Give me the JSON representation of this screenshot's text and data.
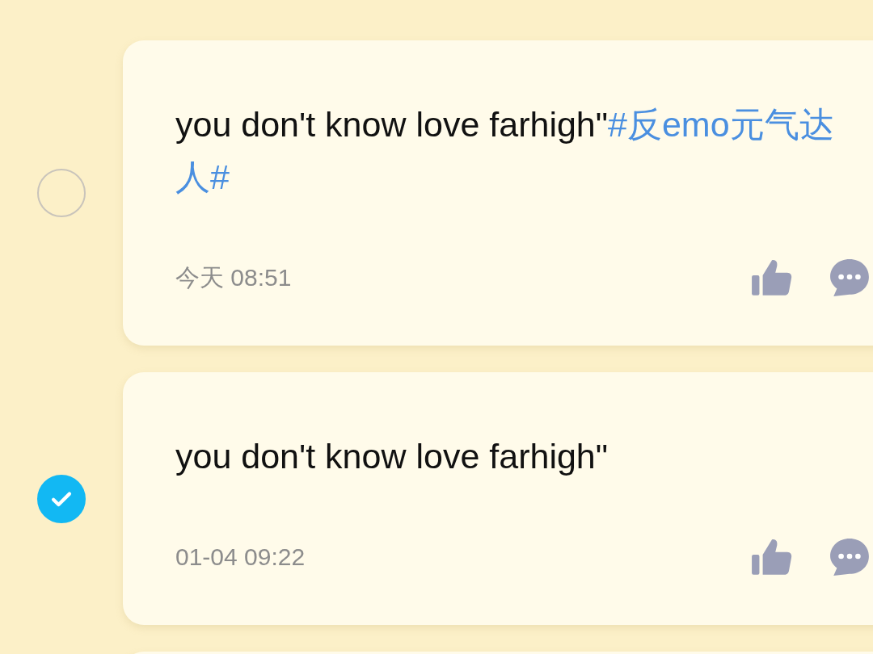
{
  "posts": [
    {
      "text": "you don't know love farhigh\"",
      "hashtag": "#反emo元气达人#",
      "time": "今天 08:51",
      "selected": false
    },
    {
      "text": "you don't know love farhigh\"",
      "time": "01-04 09:22",
      "selected": true
    }
  ]
}
